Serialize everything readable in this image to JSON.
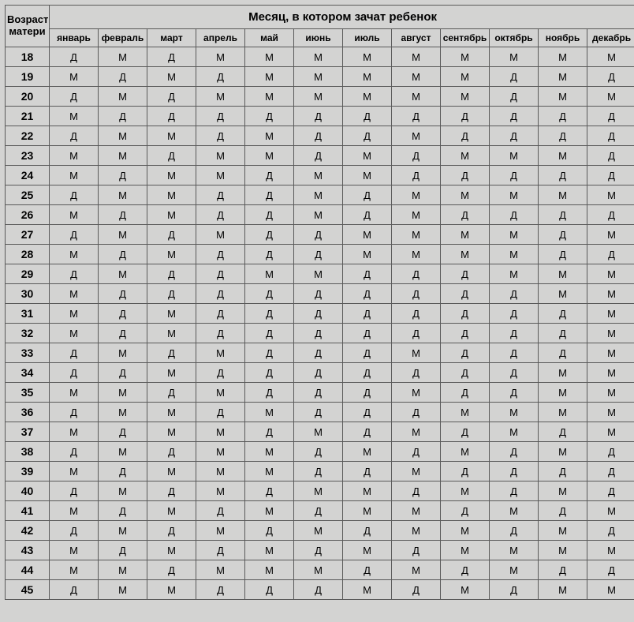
{
  "header": {
    "corner_line1": "Возраст",
    "corner_line2": "матери",
    "span_title": "Месяц, в котором зачат ребенок",
    "months": [
      "январь",
      "февраль",
      "март",
      "апрель",
      "май",
      "июнь",
      "июль",
      "август",
      "сентябрь",
      "октябрь",
      "ноябрь",
      "декабрь"
    ]
  },
  "chart_data": {
    "type": "table",
    "title": "",
    "row_label": "Возраст матери",
    "col_label": "Месяц, в котором зачат ребенок",
    "columns": [
      "январь",
      "февраль",
      "март",
      "апрель",
      "май",
      "июнь",
      "июль",
      "август",
      "сентябрь",
      "октябрь",
      "ноябрь",
      "декабрь"
    ],
    "rows": [
      {
        "age": 18,
        "values": [
          "Д",
          "М",
          "Д",
          "М",
          "М",
          "М",
          "М",
          "М",
          "М",
          "М",
          "М",
          "М"
        ]
      },
      {
        "age": 19,
        "values": [
          "М",
          "Д",
          "М",
          "Д",
          "М",
          "М",
          "М",
          "М",
          "М",
          "Д",
          "М",
          "Д"
        ]
      },
      {
        "age": 20,
        "values": [
          "Д",
          "М",
          "Д",
          "М",
          "М",
          "М",
          "М",
          "М",
          "М",
          "Д",
          "М",
          "М"
        ]
      },
      {
        "age": 21,
        "values": [
          "М",
          "Д",
          "Д",
          "Д",
          "Д",
          "Д",
          "Д",
          "Д",
          "Д",
          "Д",
          "Д",
          "Д"
        ]
      },
      {
        "age": 22,
        "values": [
          "Д",
          "М",
          "М",
          "Д",
          "М",
          "Д",
          "Д",
          "М",
          "Д",
          "Д",
          "Д",
          "Д"
        ]
      },
      {
        "age": 23,
        "values": [
          "М",
          "М",
          "Д",
          "М",
          "М",
          "Д",
          "М",
          "Д",
          "М",
          "М",
          "М",
          "Д"
        ]
      },
      {
        "age": 24,
        "values": [
          "М",
          "Д",
          "М",
          "М",
          "Д",
          "М",
          "М",
          "Д",
          "Д",
          "Д",
          "Д",
          "Д"
        ]
      },
      {
        "age": 25,
        "values": [
          "Д",
          "М",
          "М",
          "Д",
          "Д",
          "М",
          "Д",
          "М",
          "М",
          "М",
          "М",
          "М"
        ]
      },
      {
        "age": 26,
        "values": [
          "М",
          "Д",
          "М",
          "Д",
          "Д",
          "М",
          "Д",
          "М",
          "Д",
          "Д",
          "Д",
          "Д"
        ]
      },
      {
        "age": 27,
        "values": [
          "Д",
          "М",
          "Д",
          "М",
          "Д",
          "Д",
          "М",
          "М",
          "М",
          "М",
          "Д",
          "М"
        ]
      },
      {
        "age": 28,
        "values": [
          "М",
          "Д",
          "М",
          "Д",
          "Д",
          "Д",
          "М",
          "М",
          "М",
          "М",
          "Д",
          "Д"
        ]
      },
      {
        "age": 29,
        "values": [
          "Д",
          "М",
          "Д",
          "Д",
          "М",
          "М",
          "Д",
          "Д",
          "Д",
          "М",
          "М",
          "М"
        ]
      },
      {
        "age": 30,
        "values": [
          "М",
          "Д",
          "Д",
          "Д",
          "Д",
          "Д",
          "Д",
          "Д",
          "Д",
          "Д",
          "М",
          "М"
        ]
      },
      {
        "age": 31,
        "values": [
          "М",
          "Д",
          "М",
          "Д",
          "Д",
          "Д",
          "Д",
          "Д",
          "Д",
          "Д",
          "Д",
          "М"
        ]
      },
      {
        "age": 32,
        "values": [
          "М",
          "Д",
          "М",
          "Д",
          "Д",
          "Д",
          "Д",
          "Д",
          "Д",
          "Д",
          "Д",
          "М"
        ]
      },
      {
        "age": 33,
        "values": [
          "Д",
          "М",
          "Д",
          "М",
          "Д",
          "Д",
          "Д",
          "М",
          "Д",
          "Д",
          "Д",
          "М"
        ]
      },
      {
        "age": 34,
        "values": [
          "Д",
          "Д",
          "М",
          "Д",
          "Д",
          "Д",
          "Д",
          "Д",
          "Д",
          "Д",
          "М",
          "М"
        ]
      },
      {
        "age": 35,
        "values": [
          "М",
          "М",
          "Д",
          "М",
          "Д",
          "Д",
          "Д",
          "М",
          "Д",
          "Д",
          "М",
          "М"
        ]
      },
      {
        "age": 36,
        "values": [
          "Д",
          "М",
          "М",
          "Д",
          "М",
          "Д",
          "Д",
          "Д",
          "М",
          "М",
          "М",
          "М"
        ]
      },
      {
        "age": 37,
        "values": [
          "М",
          "Д",
          "М",
          "М",
          "Д",
          "М",
          "Д",
          "М",
          "Д",
          "М",
          "Д",
          "М"
        ]
      },
      {
        "age": 38,
        "values": [
          "Д",
          "М",
          "Д",
          "М",
          "М",
          "Д",
          "М",
          "Д",
          "М",
          "Д",
          "М",
          "Д"
        ]
      },
      {
        "age": 39,
        "values": [
          "М",
          "Д",
          "М",
          "М",
          "М",
          "Д",
          "Д",
          "М",
          "Д",
          "Д",
          "Д",
          "Д"
        ]
      },
      {
        "age": 40,
        "values": [
          "Д",
          "М",
          "Д",
          "М",
          "Д",
          "М",
          "М",
          "Д",
          "М",
          "Д",
          "М",
          "Д"
        ]
      },
      {
        "age": 41,
        "values": [
          "М",
          "Д",
          "М",
          "Д",
          "М",
          "Д",
          "М",
          "М",
          "Д",
          "М",
          "Д",
          "М"
        ]
      },
      {
        "age": 42,
        "values": [
          "Д",
          "М",
          "Д",
          "М",
          "Д",
          "М",
          "Д",
          "М",
          "М",
          "Д",
          "М",
          "Д"
        ]
      },
      {
        "age": 43,
        "values": [
          "М",
          "Д",
          "М",
          "Д",
          "М",
          "Д",
          "М",
          "Д",
          "М",
          "М",
          "М",
          "М"
        ]
      },
      {
        "age": 44,
        "values": [
          "М",
          "М",
          "Д",
          "М",
          "М",
          "М",
          "Д",
          "М",
          "Д",
          "М",
          "Д",
          "Д"
        ]
      },
      {
        "age": 45,
        "values": [
          "Д",
          "М",
          "М",
          "Д",
          "Д",
          "Д",
          "М",
          "Д",
          "М",
          "Д",
          "М",
          "М"
        ]
      }
    ]
  }
}
